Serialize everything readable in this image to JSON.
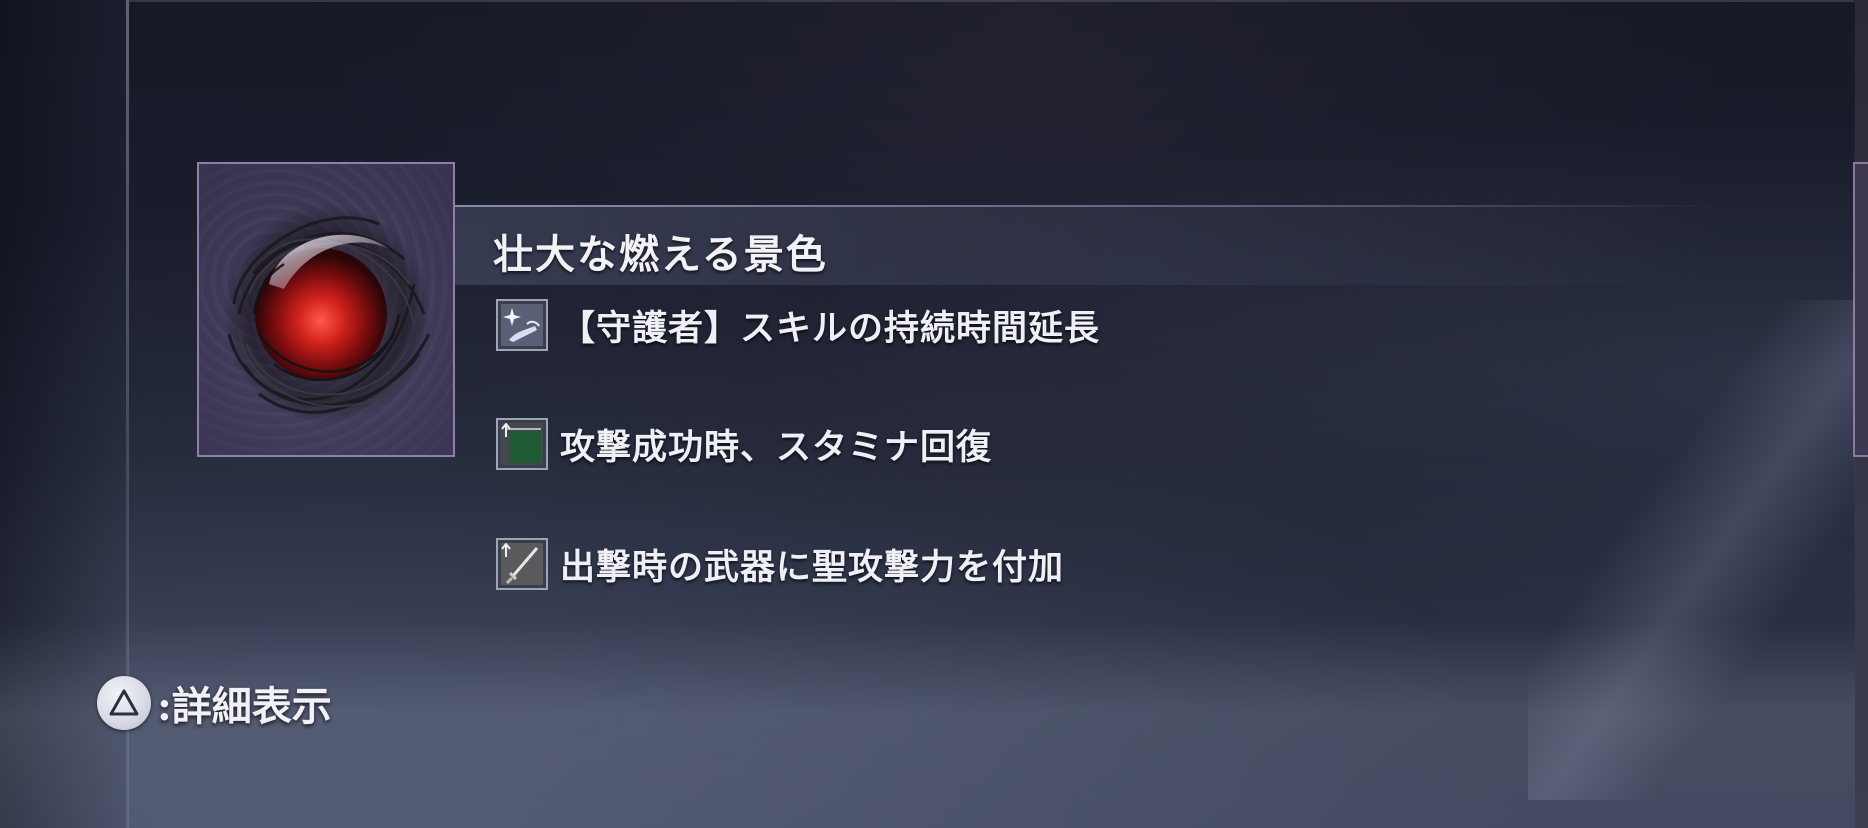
{
  "item": {
    "name": "壮大な燃える景色",
    "image_icon": "burning-orb-icon",
    "frame_color": "#8f7ea8"
  },
  "effects": [
    {
      "icon": "guardian-skill-icon",
      "text": "【守護者】スキルの持続時間延長"
    },
    {
      "icon": "stamina-recovery-icon",
      "text": "攻撃成功時、スタミナ回復"
    },
    {
      "icon": "holy-weapon-icon",
      "text": "出撃時の武器に聖攻撃力を付加"
    }
  ],
  "hint": {
    "button_icon": "triangle-button-icon",
    "label": ":詳細表示"
  },
  "colors": {
    "background": "#1b1f2e",
    "text": "#eef0f6",
    "accent_purple": "#8f7ea8",
    "stamina_green": "#1f5a34"
  }
}
